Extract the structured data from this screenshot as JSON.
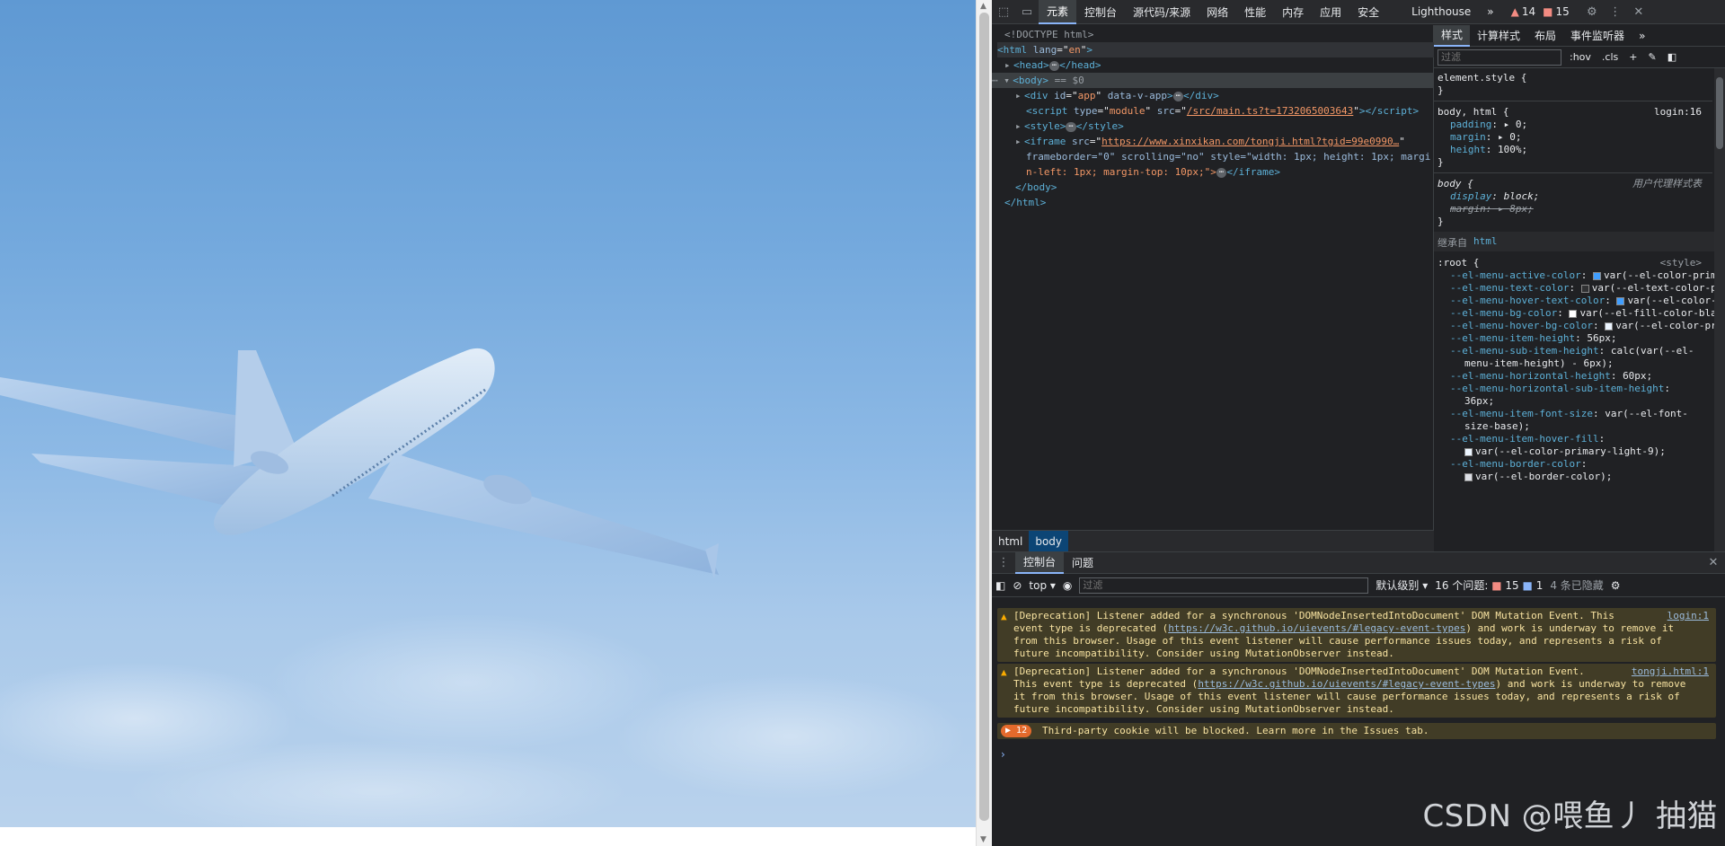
{
  "devtools": {
    "top_tabs": [
      "元素",
      "控制台",
      "源代码/来源",
      "网络",
      "性能",
      "内存",
      "应用",
      "安全",
      "Lighthouse"
    ],
    "more": "»",
    "warn_count": "14",
    "error_count": "15",
    "elements": {
      "doctype": "<!DOCTYPE html>",
      "html_open": "html",
      "html_attr": "lang",
      "html_attr_val": "en",
      "head": "head",
      "body": "body",
      "body_marker": "== $0",
      "div_attr1": "id",
      "div_val1": "app",
      "div_attr2": "data-v-app",
      "script_attr1": "type",
      "script_val1": "module",
      "script_attr2": "src",
      "script_val2": "/src/main.ts?t=1732065003643",
      "style": "style",
      "iframe_src": "https://www.xinxikan.com/tongji.html?tgid=99e0990…",
      "iframe_attrs": "frameborder=\"0\" scrolling=\"no\" style=\"width: 1px; height: 1px; margi",
      "iframe_attrs2": "n-left: 1px; margin-top: 10px;\">",
      "body_close": "</body>",
      "html_close": "</html>"
    },
    "breadcrumb": [
      "html",
      "body"
    ],
    "styles": {
      "tabs": [
        "样式",
        "计算样式",
        "布局",
        "事件监听器"
      ],
      "filter_placeholder": "过滤",
      "toolbar": [
        ":hov",
        ".cls",
        "+"
      ],
      "element_style": "element.style {",
      "close": "}",
      "rule1_selector": "body, html {",
      "rule1_src": "login:16",
      "rule1_props": [
        {
          "p": "padding",
          "v": "▸ 0;"
        },
        {
          "p": "margin",
          "v": "▸ 0;"
        },
        {
          "p": "height",
          "v": "100%;"
        }
      ],
      "rule2_selector": "body {",
      "rule2_src": "用户代理样式表",
      "rule2_props": [
        {
          "p": "display",
          "v": "block;"
        },
        {
          "p": "margin:",
          "v": "▸ 8px;"
        }
      ],
      "inherit_label": "继承自",
      "inherit_tag": "html",
      "root_selector": ":root {",
      "root_src": "<style>",
      "root_props": [
        {
          "p": "--el-menu-active-color",
          "v": "var(--el-color-primary);",
          "c": "#409eff"
        },
        {
          "p": "--el-menu-text-color",
          "v": "var(--el-text-color-primary);",
          "c": "#303133"
        },
        {
          "p": "--el-menu-hover-text-color",
          "v": "var(--el-color-primary);",
          "c": "#409eff"
        },
        {
          "p": "--el-menu-bg-color",
          "v": "var(--el-fill-color-blank);",
          "c": "#ffffff"
        },
        {
          "p": "--el-menu-hover-bg-color",
          "v": "var(--el-color-primary-light-9);",
          "c": "#ecf5ff"
        },
        {
          "p": "--el-menu-item-height",
          "v": "56px;"
        },
        {
          "p": "--el-menu-sub-item-height",
          "v": "calc(var(--el-"
        },
        {
          "p": "",
          "v": "menu-item-height) - 6px);"
        },
        {
          "p": "--el-menu-horizontal-height",
          "v": "60px;"
        },
        {
          "p": "--el-menu-horizontal-sub-item-height",
          "v": ""
        },
        {
          "p": "",
          "v": "36px;"
        },
        {
          "p": "--el-menu-item-font-size",
          "v": "var(--el-font-"
        },
        {
          "p": "",
          "v": "size-base);"
        },
        {
          "p": "--el-menu-item-hover-fill",
          "v": ""
        },
        {
          "p": "",
          "v": "var(--el-color-primary-light-9);",
          "c": "#ecf5ff"
        },
        {
          "p": "--el-menu-border-color",
          "v": ""
        },
        {
          "p": "",
          "v": "var(--el-border-color);",
          "c": "#dcdfe6"
        }
      ]
    },
    "drawer": {
      "tabs": [
        "控制台",
        "问题"
      ],
      "context": "top",
      "filter_placeholder": "过滤",
      "level": "默认级别",
      "issues": "16 个问题:",
      "issues_err": "15",
      "issues_info": "1",
      "hidden": "4 条已隐藏",
      "messages": [
        {
          "text1": "[Deprecation] Listener added for a synchronous 'DOMNodeInsertedIntoDocument' DOM Mutation Event. This",
          "text2a": "event type is deprecated (",
          "link": "https://w3c.github.io/uievents/#legacy-event-types",
          "text2b": ") and work is underway to remove it",
          "text3": "from this browser. Usage of this event listener will cause performance issues today, and represents a risk of",
          "text4": "future incompatibility. Consider using MutationObserver instead.",
          "src": "login:1"
        },
        {
          "text1": "[Deprecation] Listener added for a synchronous 'DOMNodeInsertedIntoDocument' DOM Mutation Event.",
          "text2a": "This event type is deprecated (",
          "link": "https://w3c.github.io/uievents/#legacy-event-types",
          "text2b": ") and work is underway to remove",
          "text3": "it from this browser. Usage of this event listener will cause performance issues today, and represents a risk of",
          "text4": "future incompatibility. Consider using MutationObserver instead.",
          "src": "tongji.html:1"
        }
      ],
      "cookie_count": "12",
      "cookie_msg": "Third-party cookie will be blocked. Learn more in the Issues tab."
    }
  },
  "watermark": "CSDN @喂鱼丿 抽猫"
}
